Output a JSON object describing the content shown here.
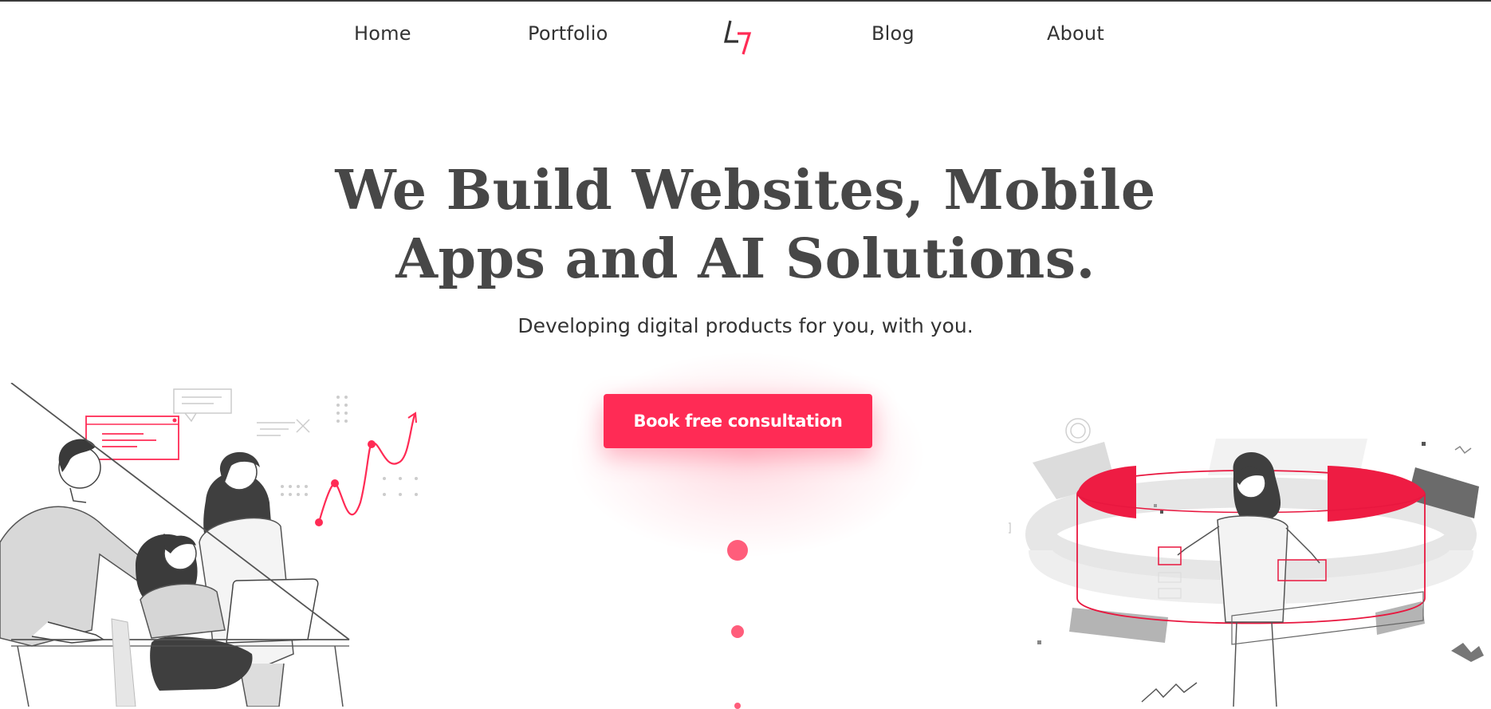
{
  "nav": {
    "home": "Home",
    "portfolio": "Portfolio",
    "blog": "Blog",
    "about": "About"
  },
  "hero": {
    "headline_line1": "We Build Websites, Mobile",
    "headline_line2": "Apps and AI Solutions.",
    "subheadline": "Developing digital products for you, with you.",
    "cta_label": "Book free consultation"
  },
  "colors": {
    "accent": "#ff2b55",
    "heading": "#474747",
    "text": "#333333"
  },
  "icons": {
    "logo": "l7-logo"
  }
}
